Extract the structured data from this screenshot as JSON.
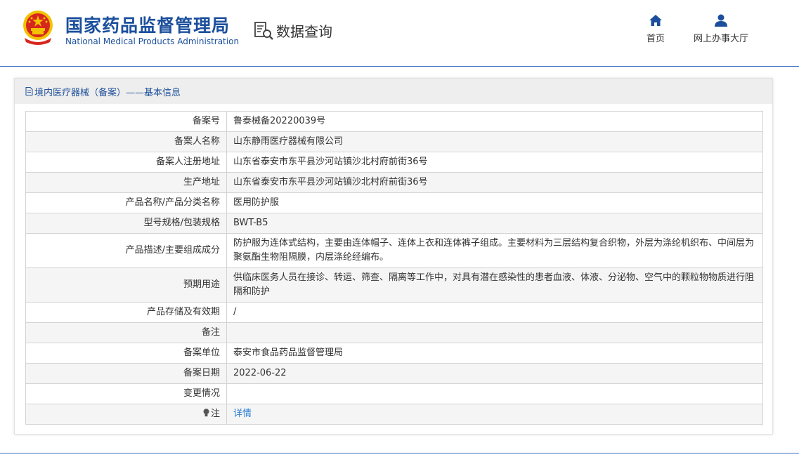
{
  "header": {
    "logo_cn": "国家药品监督管理局",
    "logo_en": "National Medical Products Administration",
    "query_label": "数据查询",
    "nav": [
      {
        "label": "首页",
        "icon": "home-icon"
      },
      {
        "label": "网上办事大厅",
        "icon": "user-icon"
      }
    ]
  },
  "card": {
    "title": "境内医疗器械（备案）——基本信息",
    "rows": [
      {
        "label": "备案号",
        "value": "鲁泰械备20220039号"
      },
      {
        "label": "备案人名称",
        "value": "山东静雨医疗器械有限公司"
      },
      {
        "label": "备案人注册地址",
        "value": "山东省泰安市东平县沙河站镇沙北村府前街36号"
      },
      {
        "label": "生产地址",
        "value": "山东省泰安市东平县沙河站镇沙北村府前街36号"
      },
      {
        "label": "产品名称/产品分类名称",
        "value": "医用防护服"
      },
      {
        "label": "型号规格/包装规格",
        "value": "BWT-B5"
      },
      {
        "label": "产品描述/主要组成成分",
        "value": "防护服为连体式结构，主要由连体帽子、连体上衣和连体裤子组成。主要材料为三层结构复合织物，外层为涤纶机织布、中间层为聚氨酯生物阻隔膜，内层涤纶经编布。"
      },
      {
        "label": "预期用途",
        "value": "供临床医务人员在接诊、转运、筛查、隔离等工作中，对具有潜在感染性的患者血液、体液、分泌物、空气中的颗粒物物质进行阻隔和防护"
      },
      {
        "label": "产品存储及有效期",
        "value": "/"
      },
      {
        "label": "备注",
        "value": ""
      },
      {
        "label": "备案单位",
        "value": "泰安市食品药品监督管理局"
      },
      {
        "label": "备案日期",
        "value": "2022-06-22"
      },
      {
        "label": "变更情况",
        "value": ""
      },
      {
        "label": "注",
        "value": "详情",
        "icon": "lightbulb-icon"
      }
    ]
  },
  "colors": {
    "brand_blue": "#1b4f9c",
    "link_blue": "#2a7dd1",
    "emblem_red": "#d7261e",
    "emblem_gold": "#f2c200"
  }
}
